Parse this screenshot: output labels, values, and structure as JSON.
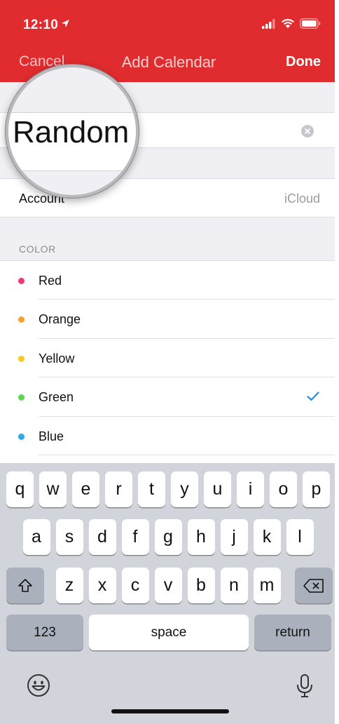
{
  "status_bar": {
    "time": "12:10"
  },
  "nav": {
    "cancel": "Cancel",
    "title": "Add Calendar",
    "done": "Done"
  },
  "name_field": {
    "value": "Random"
  },
  "account": {
    "label": "Account",
    "value": "iCloud"
  },
  "color_section": {
    "header": "COLOR",
    "items": [
      {
        "name": "Red",
        "color": "#ea3a78",
        "selected": false
      },
      {
        "name": "Orange",
        "color": "#f5a02e",
        "selected": false
      },
      {
        "name": "Yellow",
        "color": "#f4cc2c",
        "selected": false
      },
      {
        "name": "Green",
        "color": "#5fd452",
        "selected": true
      },
      {
        "name": "Blue",
        "color": "#2fa8e8",
        "selected": false
      }
    ],
    "check_color": "#2a8bd8"
  },
  "keyboard": {
    "row1": [
      "q",
      "w",
      "e",
      "r",
      "t",
      "y",
      "u",
      "i",
      "o",
      "p"
    ],
    "row2": [
      "a",
      "s",
      "d",
      "f",
      "g",
      "h",
      "j",
      "k",
      "l"
    ],
    "row3": [
      "z",
      "x",
      "c",
      "v",
      "b",
      "n",
      "m"
    ],
    "numbers_key": "123",
    "space_key": "space",
    "return_key": "return"
  },
  "colors": {
    "nav_background": "#e02b2f",
    "keyboard_background": "#d1d4db"
  }
}
